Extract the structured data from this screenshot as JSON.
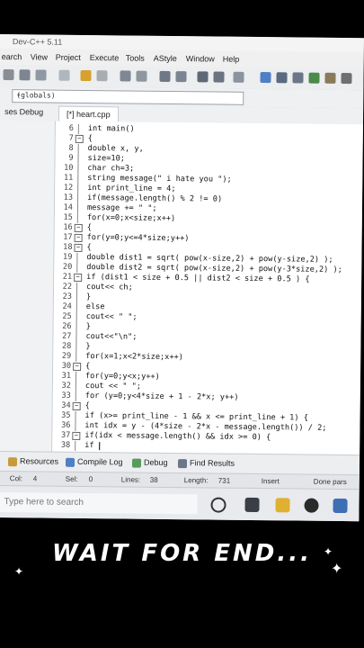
{
  "window": {
    "title": "Dev-C++ 5.11"
  },
  "menu": [
    "earch",
    "View",
    "Project",
    "Execute",
    "Tools",
    "AStyle",
    "Window",
    "Help"
  ],
  "scope": {
    "value": "(globals)"
  },
  "tabs": {
    "left": "ses  Debug",
    "file": "[*] heart.cpp"
  },
  "code": [
    {
      "n": "6",
      "fold": "",
      "text": "int main()"
    },
    {
      "n": "7",
      "fold": "-",
      "text": "{"
    },
    {
      "n": "8",
      "fold": "",
      "text": "double x, y,"
    },
    {
      "n": "9",
      "fold": "",
      "text": "size=10;"
    },
    {
      "n": "10",
      "fold": "",
      "text": "char ch=3;"
    },
    {
      "n": "11",
      "fold": "",
      "text": "string message(\" i hate you \");"
    },
    {
      "n": "12",
      "fold": "",
      "text": "int print_line = 4;"
    },
    {
      "n": "13",
      "fold": "",
      "text": "if(message.length() % 2 != 0)"
    },
    {
      "n": "14",
      "fold": "",
      "text": "message += \" \";"
    },
    {
      "n": "15",
      "fold": "",
      "text": "for(x=0;x<size;x++)"
    },
    {
      "n": "16",
      "fold": "-",
      "text": "{"
    },
    {
      "n": "17",
      "fold": "-",
      "text": "for(y=0;y<=4*size;y++)"
    },
    {
      "n": "18",
      "fold": "-",
      "text": "{"
    },
    {
      "n": "19",
      "fold": "",
      "text": "double dist1 = sqrt( pow(x-size,2) + pow(y-size,2) );"
    },
    {
      "n": "20",
      "fold": "",
      "text": "double dist2 = sqrt( pow(x-size,2) + pow(y-3*size,2) );"
    },
    {
      "n": "21",
      "fold": "-",
      "text": "if (dist1 < size + 0.5 || dist2 < size + 0.5 ) {"
    },
    {
      "n": "22",
      "fold": "",
      "text": "cout<< ch;"
    },
    {
      "n": "23",
      "fold": "end",
      "text": "}"
    },
    {
      "n": "24",
      "fold": "",
      "text": "else"
    },
    {
      "n": "25",
      "fold": "",
      "text": "cout<< \" \";"
    },
    {
      "n": "26",
      "fold": "end",
      "text": "}"
    },
    {
      "n": "27",
      "fold": "",
      "text": "cout<<\"\\n\";"
    },
    {
      "n": "28",
      "fold": "end",
      "text": "}"
    },
    {
      "n": "29",
      "fold": "",
      "text": "for(x=1;x<2*size;x++)"
    },
    {
      "n": "30",
      "fold": "-",
      "text": "{"
    },
    {
      "n": "31",
      "fold": "",
      "text": "for(y=0;y<x;y++)"
    },
    {
      "n": "32",
      "fold": "",
      "text": "cout << \" \";"
    },
    {
      "n": "33",
      "fold": "",
      "text": "for (y=0;y<4*size + 1 - 2*x; y++)"
    },
    {
      "n": "34",
      "fold": "-",
      "text": "{"
    },
    {
      "n": "35",
      "fold": "",
      "text": "if (x>= print_line - 1 && x <= print_line + 1) {"
    },
    {
      "n": "36",
      "fold": "",
      "text": "int idx = y - (4*size - 2*x - message.length()) / 2;"
    },
    {
      "n": "37",
      "fold": "-",
      "text": "if(idx < message.length() && idx >= 0) {"
    },
    {
      "n": "38",
      "fold": "",
      "text": "if"
    }
  ],
  "bottom_tabs": [
    "Resources",
    "Compile Log",
    "Debug",
    "Find Results"
  ],
  "status": {
    "col_label": "Col:",
    "col": "4",
    "sel_label": "Sel:",
    "sel": "0",
    "lines_label": "Lines:",
    "lines": "38",
    "length_label": "Length:",
    "length": "731",
    "mode": "Insert",
    "message": "Done pars"
  },
  "taskbar": {
    "search_placeholder": "Type here to search"
  },
  "caption": "WAIT FOR END..."
}
